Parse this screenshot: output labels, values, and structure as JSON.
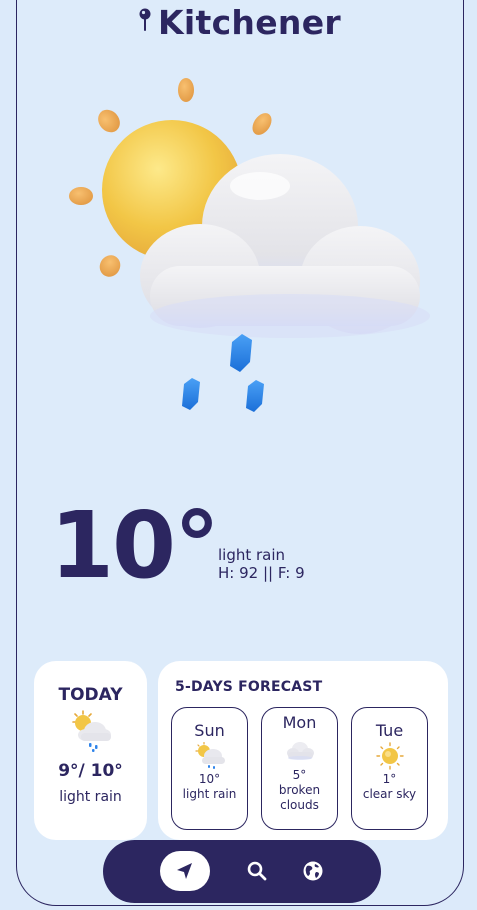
{
  "location": {
    "city": "Kitchener"
  },
  "current": {
    "temperature": "10°",
    "description": "light rain",
    "stats": "H: 92 || F: 9"
  },
  "today": {
    "title": "TODAY",
    "range": "9°/ 10°",
    "description": "light rain",
    "icon": "sun-cloud-rain-icon"
  },
  "forecast": {
    "title": "5-DAYS FORECAST",
    "days": [
      {
        "name": "Sun",
        "temp": "10°",
        "desc": "light rain",
        "icon": "sun-cloud-rain-icon"
      },
      {
        "name": "Mon",
        "temp": "5°",
        "desc": "broken clouds",
        "icon": "cloud-icon"
      },
      {
        "name": "Tue",
        "temp": "1°",
        "desc": "clear sky",
        "icon": "sun-icon"
      }
    ]
  },
  "nav": {
    "items": [
      {
        "icon": "location-arrow-icon",
        "active": true
      },
      {
        "icon": "search-icon",
        "active": false
      },
      {
        "icon": "globe-icon",
        "active": false
      }
    ]
  },
  "colors": {
    "background": "#dceafa",
    "primary": "#2c2660",
    "card": "#ffffff",
    "sun": "#f2c646",
    "rain": "#2f84ea"
  }
}
